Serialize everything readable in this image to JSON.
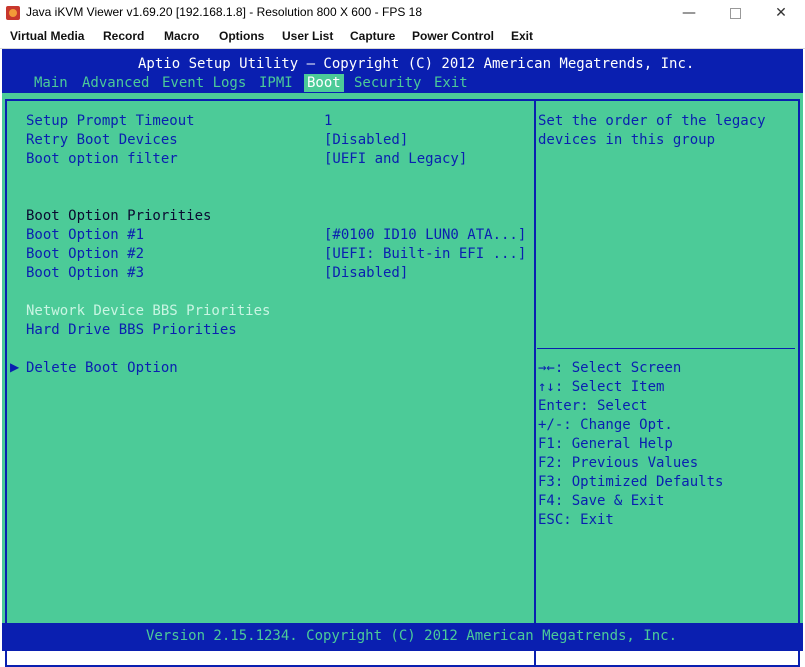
{
  "window": {
    "title": "Java iKVM Viewer v1.69.20 [192.168.1.8]  - Resolution 800 X 600 - FPS 18",
    "minimize": "—",
    "close": "✕"
  },
  "menubar": [
    "Virtual Media",
    "Record",
    "Macro",
    "Options",
    "User List",
    "Capture",
    "Power Control",
    "Exit"
  ],
  "bios": {
    "title": "Aptio Setup Utility – Copyright (C) 2012 American Megatrends, Inc.",
    "tabs": [
      "Main",
      "Advanced",
      "Event Logs",
      "IPMI",
      "Boot",
      "Security",
      "Exit"
    ],
    "active_tab": "Boot",
    "settings": [
      {
        "label": "Setup Prompt Timeout",
        "value": "1"
      },
      {
        "label": "Retry Boot Devices",
        "value": "[Disabled]"
      },
      {
        "label": "Boot option filter",
        "value": "[UEFI and Legacy]"
      },
      {
        "label": "Boot Option Priorities",
        "value": ""
      },
      {
        "label": "Boot Option #1",
        "value": "[#0100 ID10 LUN0 ATA...]"
      },
      {
        "label": "Boot Option #2",
        "value": "[UEFI: Built-in EFI ...]"
      },
      {
        "label": "Boot Option #3",
        "value": "[Disabled]"
      },
      {
        "label": "Network Device BBS Priorities",
        "value": ""
      },
      {
        "label": "Hard Drive BBS Priorities",
        "value": ""
      },
      {
        "label": "Delete Boot Option",
        "value": ""
      }
    ],
    "help_text": [
      "Set the order of the legacy",
      "devices in this group"
    ],
    "key_help": [
      "→←: Select Screen",
      "↑↓: Select Item",
      "Enter: Select",
      "+/-: Change Opt.",
      "F1: General Help",
      "F2: Previous Values",
      "F3: Optimized Defaults",
      "F4: Save & Exit",
      "ESC: Exit"
    ],
    "footer": "Version 2.15.1234. Copyright (C) 2012 American Megatrends, Inc.",
    "colors": {
      "background": "#4ccb98",
      "accent": "#0a1fb0",
      "highlight": "#c9f5e3"
    }
  }
}
